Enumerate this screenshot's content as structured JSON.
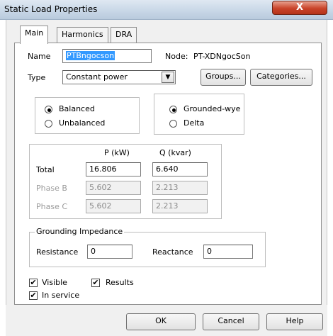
{
  "window": {
    "title": "Static Load Properties",
    "close_glyph": "X"
  },
  "tabs": [
    {
      "label": "Main",
      "active": true
    },
    {
      "label": "Harmonics",
      "active": false
    },
    {
      "label": "DRA",
      "active": false
    }
  ],
  "main": {
    "name_label": "Name",
    "name_value": "PTBngocson",
    "node_label": "Node:",
    "node_value": "PT-XDNgocSon",
    "type_label": "Type",
    "type_value": "Constant power",
    "groups_label": "Groups...",
    "categories_label": "Categories...",
    "balance": {
      "balanced_label": "Balanced",
      "unbalanced_label": "Unbalanced",
      "selected": "Balanced"
    },
    "connection": {
      "grounded_wye_label": "Grounded-wye",
      "delta_label": "Delta",
      "selected": "Grounded-wye"
    },
    "power_table": {
      "col_p": "P (kW)",
      "col_q": "Q (kvar)",
      "rows": [
        {
          "label": "Total",
          "p": "16.806",
          "q": "6.640",
          "enabled": true
        },
        {
          "label": "Phase B",
          "p": "5.602",
          "q": "2.213",
          "enabled": false
        },
        {
          "label": "Phase C",
          "p": "5.602",
          "q": "2.213",
          "enabled": false
        }
      ]
    },
    "grounding": {
      "legend": "Grounding Impedance",
      "resistance_label": "Resistance",
      "resistance_value": "0",
      "reactance_label": "Reactance",
      "reactance_value": "0"
    },
    "checks": {
      "visible_label": "Visible",
      "visible_checked": true,
      "results_label": "Results",
      "results_checked": true,
      "in_service_label": "In service",
      "in_service_checked": true,
      "check_glyph": "✔"
    }
  },
  "buttons": {
    "ok": "OK",
    "cancel": "Cancel",
    "help": "Help"
  },
  "colors": {
    "name_highlight": "#3399ff",
    "title_bar": "#c7d6e6",
    "close_button": "#c9432a"
  }
}
